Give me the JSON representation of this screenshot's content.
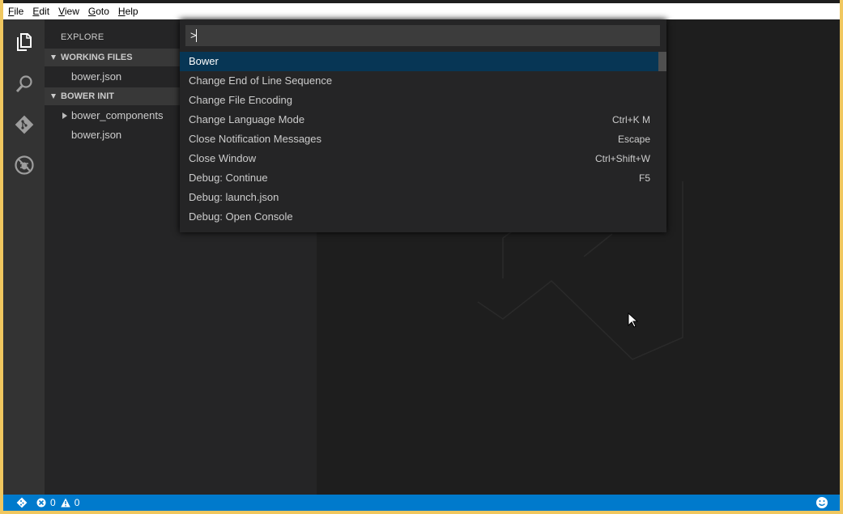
{
  "menu": {
    "items": [
      {
        "mnemonic": "F",
        "rest": "ile"
      },
      {
        "mnemonic": "E",
        "rest": "dit"
      },
      {
        "mnemonic": "V",
        "rest": "iew"
      },
      {
        "mnemonic": "G",
        "rest": "oto"
      },
      {
        "mnemonic": "H",
        "rest": "elp"
      }
    ]
  },
  "activitybar": {
    "icons": [
      "files-icon",
      "search-icon",
      "git-icon",
      "debug-icon"
    ]
  },
  "sidebar": {
    "title": "EXPLORE",
    "working_files": {
      "header": "WORKING FILES",
      "files": [
        "bower.json"
      ]
    },
    "project": {
      "header": "BOWER INIT",
      "items": [
        {
          "label": "bower_components",
          "folder": true
        },
        {
          "label": "bower.json",
          "folder": false
        }
      ]
    }
  },
  "quickopen": {
    "input_value": ">",
    "items": [
      {
        "label": "Bower",
        "keybinding": "",
        "selected": true
      },
      {
        "label": "Change End of Line Sequence",
        "keybinding": ""
      },
      {
        "label": "Change File Encoding",
        "keybinding": ""
      },
      {
        "label": "Change Language Mode",
        "keybinding": "Ctrl+K M"
      },
      {
        "label": "Close Notification Messages",
        "keybinding": "Escape"
      },
      {
        "label": "Close Window",
        "keybinding": "Ctrl+Shift+W"
      },
      {
        "label": "Debug: Continue",
        "keybinding": "F5"
      },
      {
        "label": "Debug: launch.json",
        "keybinding": ""
      },
      {
        "label": "Debug: Open Console",
        "keybinding": ""
      }
    ]
  },
  "statusbar": {
    "errors": "0",
    "warnings": "0",
    "icons": [
      "git-branch-icon",
      "error-icon",
      "warning-icon",
      "feedback-smiley-icon"
    ]
  },
  "colors": {
    "window_frame": "#f0c75f",
    "statusbar": "#007acc",
    "selected_row": "#073655",
    "activitybar": "#333333",
    "sidebar": "#252526"
  }
}
